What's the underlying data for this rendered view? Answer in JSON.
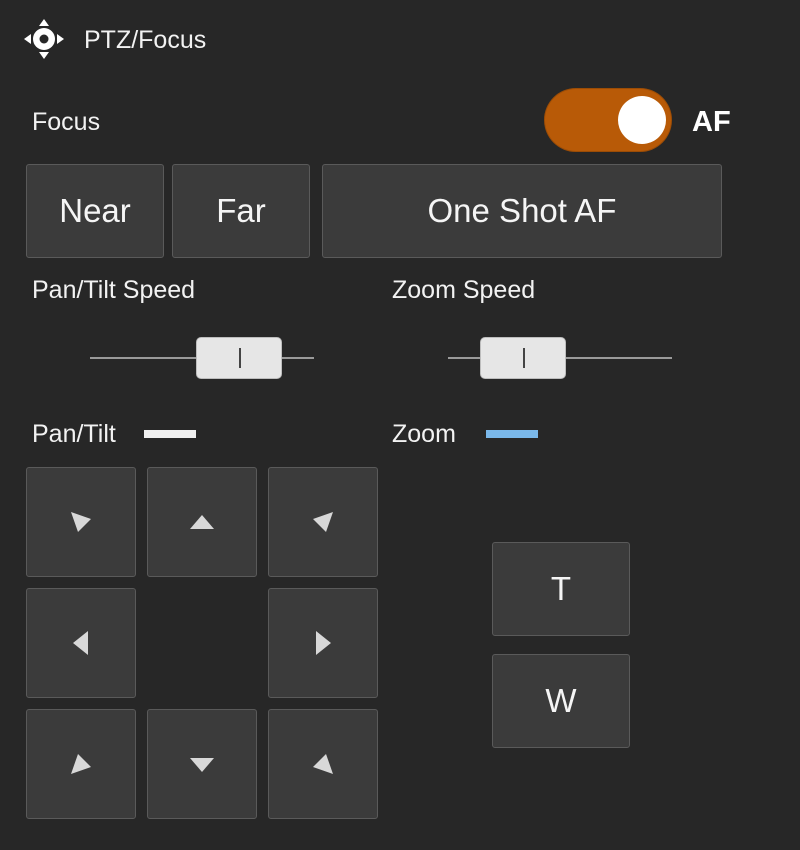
{
  "header": {
    "title": "PTZ/Focus",
    "icon": "ptz-directional-icon"
  },
  "focus": {
    "label": "Focus",
    "af_toggle": {
      "on": true,
      "label": "AF",
      "color": "#b85a07"
    },
    "buttons": {
      "near": "Near",
      "far": "Far",
      "one_shot_af": "One Shot AF"
    }
  },
  "speeds": {
    "pan_tilt_label": "Pan/Tilt Speed",
    "zoom_label": "Zoom Speed"
  },
  "pan_tilt": {
    "label": "Pan/Tilt",
    "indicator_color": "#f0f0f0",
    "pad_icons": [
      "arrow-up-left-icon",
      "arrow-up-icon",
      "arrow-up-right-icon",
      "arrow-left-icon",
      "arrow-right-icon",
      "arrow-down-left-icon",
      "arrow-down-icon",
      "arrow-down-right-icon"
    ]
  },
  "zoom": {
    "label": "Zoom",
    "indicator_color": "#7ab8ea",
    "tele": "T",
    "wide": "W"
  }
}
